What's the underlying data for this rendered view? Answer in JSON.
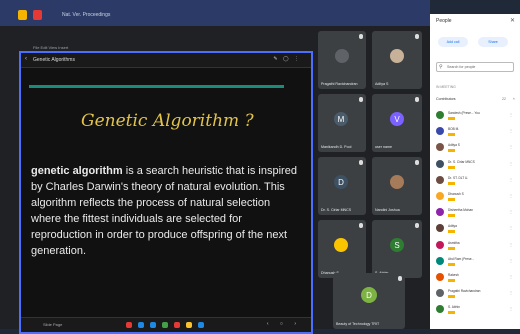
{
  "window": {
    "title": "Nat. Ver. Proceedings"
  },
  "presentation": {
    "doc_nav": "File  Edit  View  Insert",
    "slide_title": "Genetic Algorithms",
    "heading": "Genetic Algorithm ?",
    "body_bold": "genetic algorithm",
    "body_rest": " is a search heuristic that is inspired by Charles Darwin's theory of natural evolution. This algorithm reflects the process of natural selection where the fittest individuals are selected for reproduction in order to produce offspring of the next generation.",
    "bottom_label": "Slide Page",
    "dot_colors": [
      "#e53935",
      "#1e88e5",
      "#1e88e5",
      "#43a047",
      "#e53935",
      "#fbc02d",
      "#1e88e5"
    ]
  },
  "tiles": [
    {
      "name": "Pragathi Ravichandran",
      "avatar_letter": "",
      "avatar_color": "#5f6368"
    },
    {
      "name": "Aditya S",
      "avatar_letter": "",
      "avatar_color": "#c7b299"
    },
    {
      "name": "Manikandh D. Pool",
      "avatar_letter": "M",
      "avatar_color": "#4a5b6a"
    },
    {
      "name": "user name",
      "avatar_letter": "V",
      "avatar_color": "#7b61ff"
    },
    {
      "name": "Dr. S. Cirlar MNCS",
      "avatar_letter": "D",
      "avatar_color": "#3d5163"
    },
    {
      "name": "Nandini Joshua",
      "avatar_letter": "",
      "avatar_color": "#a57b5a"
    },
    {
      "name": "Dhanush S",
      "avatar_letter": "",
      "avatar_color": "#f9c400"
    },
    {
      "name": "S. Abhin",
      "avatar_letter": "S",
      "avatar_color": "#2e7d32"
    },
    {
      "name": "Beauty of Technology TRIT",
      "avatar_letter": "D",
      "avatar_color": "#7cb342"
    }
  ],
  "people": {
    "title": "People",
    "add_label": "Add call",
    "share_label": "Share",
    "search_placeholder": "Search for people",
    "section": "IN MEETING",
    "contributors_label": "Contributors",
    "contributors_count": "22",
    "list": [
      {
        "name": "Sandesh (Prese...  You",
        "color": "#2e7d32"
      },
      {
        "name": "BOB M.",
        "color": "#3949ab"
      },
      {
        "name": "Aditya S",
        "color": "#795548"
      },
      {
        "name": "Dr. S. Cirlar MNCS",
        "color": "#3d5163"
      },
      {
        "name": "Dr. ST. DLT U.",
        "color": "#6d4c41"
      },
      {
        "name": "Dhanush S",
        "color": "#f9a825"
      },
      {
        "name": "Disheetha Mohan",
        "color": "#8e24aa"
      },
      {
        "name": "Aditya",
        "color": "#5d4037"
      },
      {
        "name": "Asmitha",
        "color": "#c2185b"
      },
      {
        "name": "Abd Ram (Prese...",
        "color": "#00897b"
      },
      {
        "name": "Rakesh",
        "color": "#e65100"
      },
      {
        "name": "Pragathi Ravichandran",
        "color": "#5f6368"
      },
      {
        "name": "S. Abhin",
        "color": "#2e7d32"
      }
    ]
  }
}
